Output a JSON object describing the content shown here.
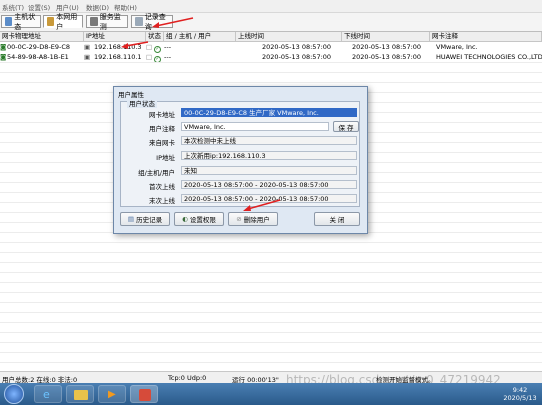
{
  "menu": [
    "系统(T)",
    "设置(S)",
    "用户(U)",
    "数据(D)",
    "帮助(H)"
  ],
  "tabs": [
    {
      "label": "主机状态",
      "active": false
    },
    {
      "label": "本网用户",
      "active": true
    },
    {
      "label": "服务监测",
      "active": false
    },
    {
      "label": "记录查询",
      "active": false
    }
  ],
  "columns": [
    "网卡物理地址",
    "IP地址",
    "状态",
    "组 / 主机 / 用户",
    "上线时间",
    "下线时间",
    "网卡注释"
  ],
  "rows": [
    {
      "mac": "00-0C-29-D8-E9-C8",
      "ip": "192.168.110.3",
      "group": "---",
      "online": "2020-05-13 08:57:00",
      "offline": "2020-05-13 08:57:00",
      "comment": "VMware, Inc."
    },
    {
      "mac": "54-89-98-A8-1B-E1",
      "ip": "192.168.110.1",
      "group": "---",
      "online": "2020-05-13 08:57:00",
      "offline": "2020-05-13 08:57:00",
      "comment": "HUAWEI TECHNOLOGIES CO.,LTD"
    }
  ],
  "dialog": {
    "title": "用户属性",
    "group_label": "用户状态",
    "fields": [
      {
        "label": "网卡地址",
        "value": "00-0C-29-D8-E9-C8 生产厂家 VMware, Inc.",
        "highlight": true
      },
      {
        "label": "用户注释",
        "value": "VMware, Inc."
      },
      {
        "label": "来自网卡",
        "value": "本次检测中未上线"
      },
      {
        "label": "IP地址",
        "value": "上次新用ip:192.168.110.3"
      },
      {
        "label": "组/主机/用户",
        "value": "未知"
      },
      {
        "label": "首次上线",
        "value": "2020-05-13 08:57:00 - 2020-05-13 08:57:00"
      },
      {
        "label": "末次上线",
        "value": "2020-05-13 08:57:00 - 2020-05-13 08:57:00"
      }
    ],
    "save_label": "保 存",
    "buttons": {
      "history": "历史记录",
      "permissions": "设置权限",
      "delete": "删除用户",
      "close": "关 闭"
    }
  },
  "status": {
    "users": "用户总数:2 在线:0 非法:0",
    "ports": "Tcp:0 Udp:0",
    "runtime": "运行 00:00'13\"",
    "msg": "检测开始监督模式。"
  },
  "watermark": "https://blog.csdn.net/m0_47219942",
  "clock": {
    "time": "9:42",
    "date": "2020/5/13"
  },
  "colors": {
    "highlight": "#3169c6",
    "accent_arrow": "#e02020"
  }
}
